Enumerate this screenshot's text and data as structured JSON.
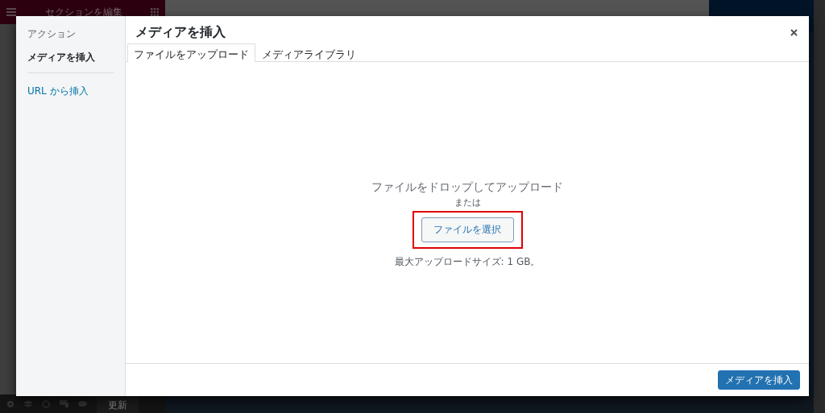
{
  "editor": {
    "panel_title": "セクションを編集",
    "update_button": "更新"
  },
  "modal": {
    "sidebar": {
      "heading": "アクション",
      "items": [
        {
          "label": "メディアを挿入",
          "selected": true
        },
        {
          "label": "URL から挿入",
          "selected": false
        }
      ]
    },
    "title": "メディアを挿入",
    "tabs": [
      {
        "label": "ファイルをアップロード",
        "selected": true
      },
      {
        "label": "メディアライブラリ",
        "selected": false
      }
    ],
    "upload": {
      "instructions": "ファイルをドロップしてアップロード",
      "or": "または",
      "select_button": "ファイルを選択",
      "highlighted": true,
      "max_size": "最大アップロードサイズ: 1 GB。"
    },
    "primary_button": "メディアを挿入"
  }
}
